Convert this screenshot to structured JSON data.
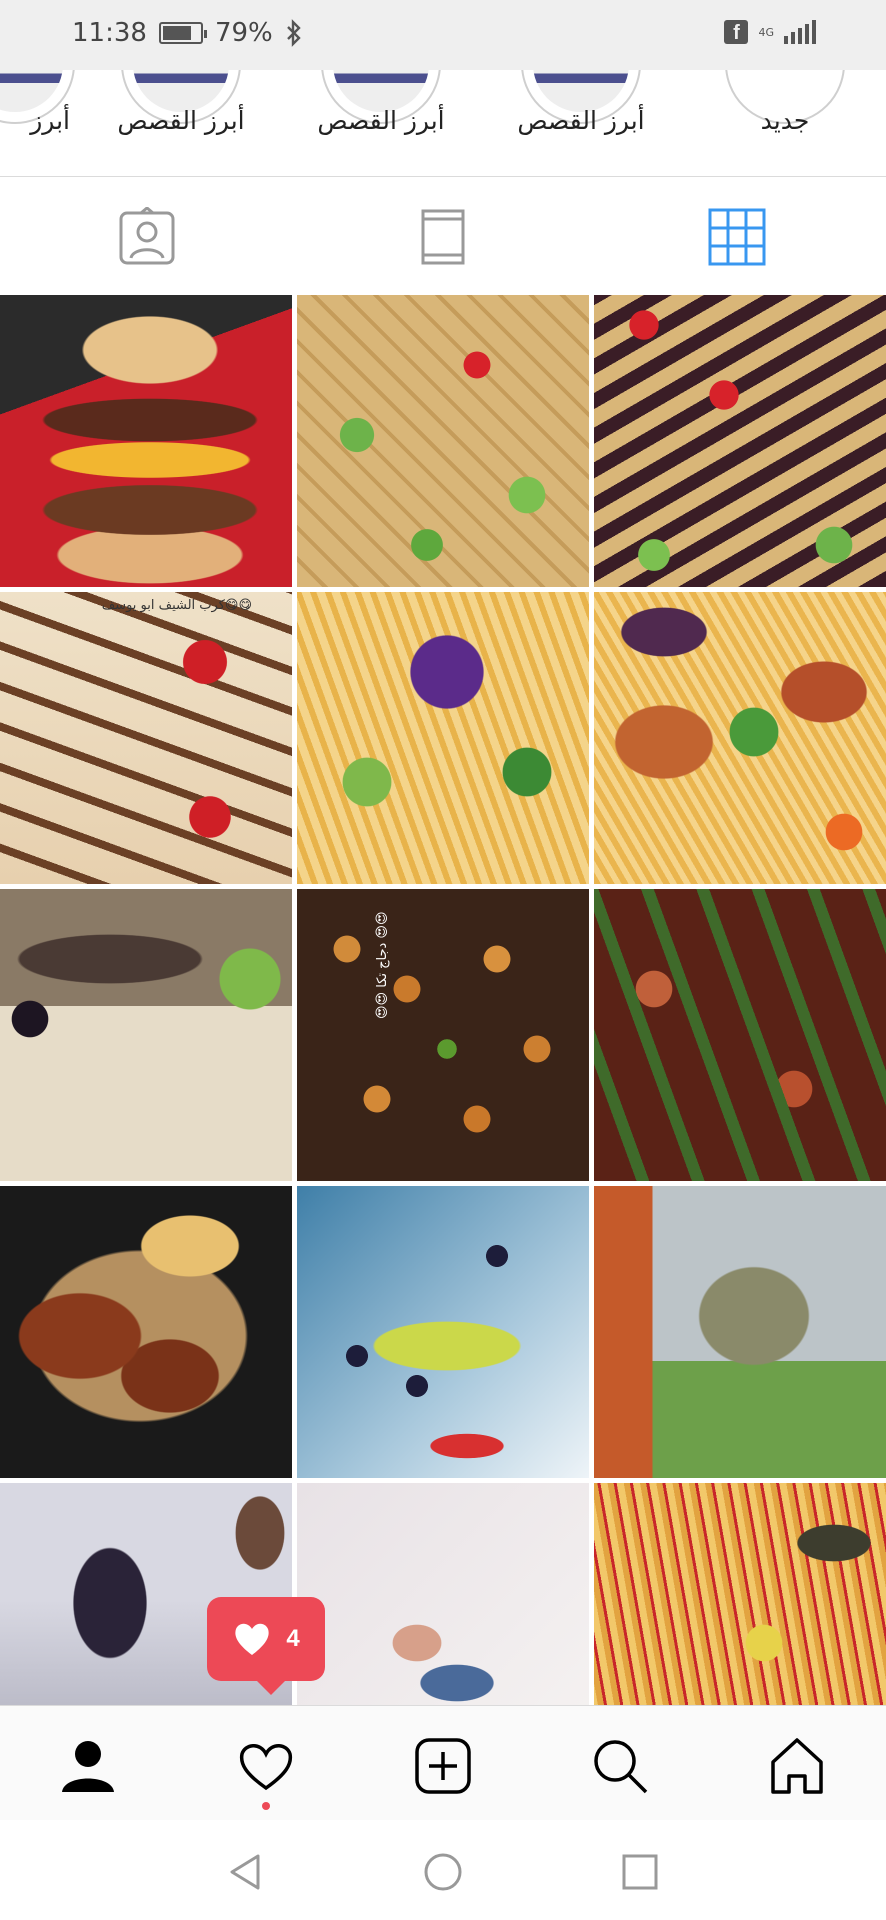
{
  "status_bar": {
    "time": "11:38",
    "battery_percent": "79%",
    "battery_level": 0.79,
    "network": "4G",
    "icons": [
      "battery-icon",
      "bluetooth-icon",
      "facebook-icon",
      "signal-icon"
    ]
  },
  "highlights": [
    {
      "label": "أبرز"
    },
    {
      "label": "أبرز القصص"
    },
    {
      "label": "أبرز القصص"
    },
    {
      "label": "أبرز القصص"
    },
    {
      "label": "جديد"
    }
  ],
  "tabs": [
    {
      "name": "tagged-tab",
      "icon": "person-tag-icon",
      "selected": false
    },
    {
      "name": "igtv-tab",
      "icon": "feed-icon",
      "selected": false
    },
    {
      "name": "grid-tab",
      "icon": "grid-icon",
      "selected": true
    }
  ],
  "colors": {
    "accent_blue": "#3897f0",
    "notification_red": "#ed4956",
    "icon_gray": "#999999",
    "dark": "#262626"
  },
  "grid": {
    "posts": [
      {
        "art": "burger"
      },
      {
        "art": "waffle"
      },
      {
        "art": "berry"
      },
      {
        "art": "crepe",
        "caption": "😋😋كرب الشيف ابو يوسف"
      },
      {
        "art": "salad"
      },
      {
        "art": "chicken"
      },
      {
        "art": "meat"
      },
      {
        "art": "tikka1",
        "caption": "😍😍 دجاج تكا 😍😍"
      },
      {
        "art": "tikka2"
      },
      {
        "art": "platter"
      },
      {
        "art": "fruit"
      },
      {
        "art": "trays"
      },
      {
        "art": "person"
      },
      {
        "art": "foot"
      },
      {
        "art": "fries"
      }
    ]
  },
  "likes_notification": {
    "count": "4",
    "icon": "heart-icon"
  },
  "bottom_nav": [
    {
      "name": "profile",
      "icon": "profile-icon",
      "active": true
    },
    {
      "name": "activity",
      "icon": "heart-outline-icon",
      "active": false
    },
    {
      "name": "new-post",
      "icon": "add-post-icon",
      "active": false
    },
    {
      "name": "search",
      "icon": "search-icon",
      "active": false
    },
    {
      "name": "home",
      "icon": "home-icon",
      "active": false
    }
  ],
  "system_nav": [
    "back-icon",
    "home-circle-icon",
    "recents-icon"
  ]
}
